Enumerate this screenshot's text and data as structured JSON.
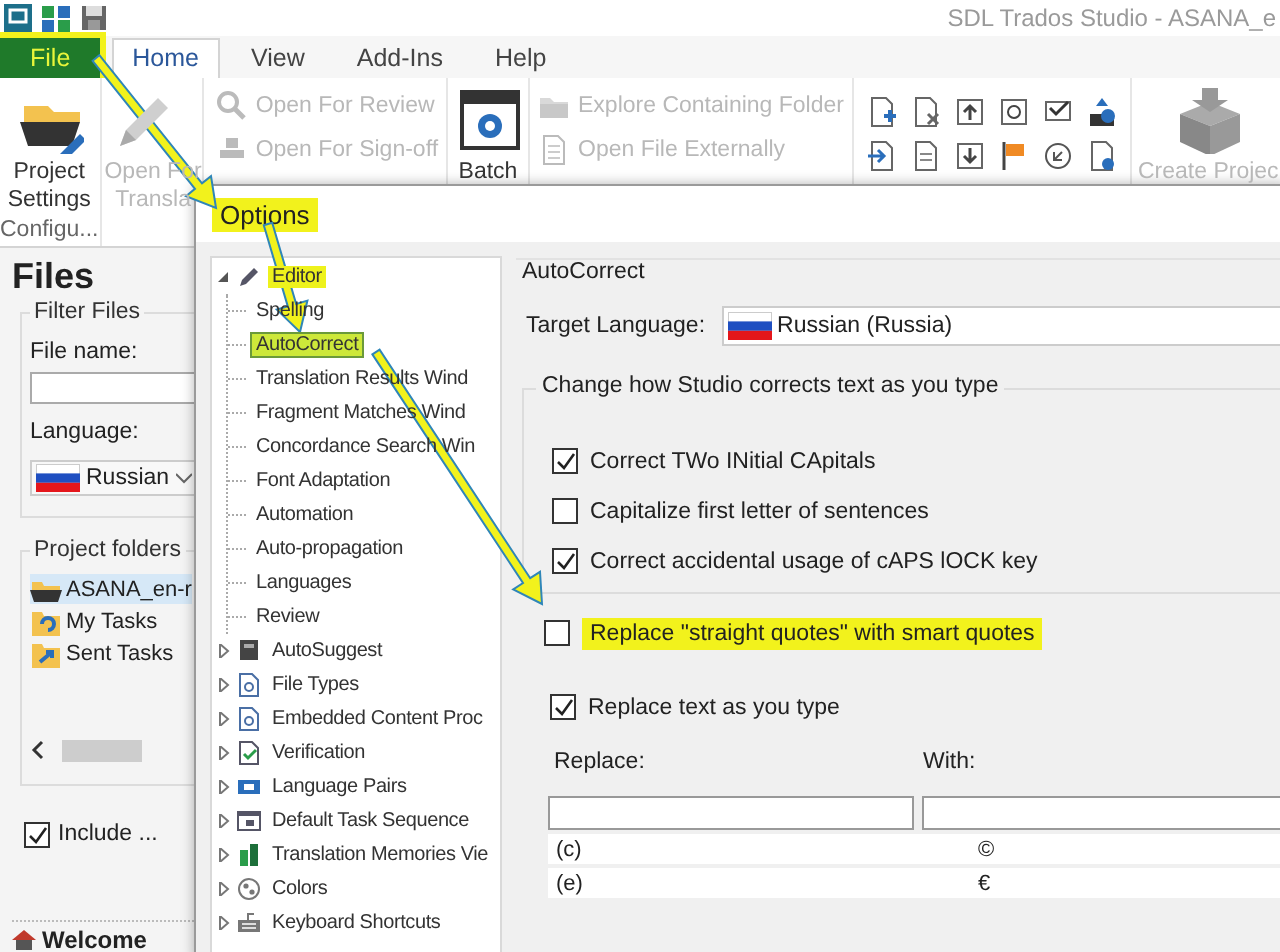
{
  "app": {
    "title": "SDL Trados Studio - ASANA_e"
  },
  "ribbon_tabs": [
    {
      "label": "File",
      "kind": "file",
      "selected": false,
      "highlighted": true
    },
    {
      "label": "Home",
      "kind": "tab",
      "selected": true,
      "highlighted": false
    },
    {
      "label": "View",
      "kind": "tab",
      "selected": false,
      "highlighted": false
    },
    {
      "label": "Add-Ins",
      "kind": "tab",
      "selected": false,
      "highlighted": false
    },
    {
      "label": "Help",
      "kind": "tab",
      "selected": false,
      "highlighted": false
    }
  ],
  "ribbon": [
    {
      "kind": "large",
      "lines": [
        "Project",
        "Settings"
      ],
      "caption": "Configu...",
      "disabled": false
    },
    {
      "kind": "large",
      "lines": [
        "Open For",
        "Transla"
      ],
      "disabled": true
    },
    {
      "kind": "small",
      "items": [
        {
          "label": "Open For Review",
          "disabled": true
        },
        {
          "label": "Open For Sign-off",
          "disabled": true
        }
      ]
    },
    {
      "kind": "large",
      "lines": [
        "Batch"
      ],
      "disabled": false
    },
    {
      "kind": "small",
      "items": [
        {
          "label": "Explore Containing Folder",
          "disabled": true
        },
        {
          "label": "Open File Externally",
          "disabled": true
        }
      ]
    },
    {
      "kind": "grid"
    },
    {
      "kind": "large",
      "lines": [
        "Create Projec"
      ],
      "disabled": true
    }
  ],
  "files_panel": {
    "heading": "Files",
    "filter_title": "Filter Files",
    "file_name_label": "File name:",
    "language_label": "Language:",
    "language": "Russian",
    "folders_title": "Project folders",
    "folders": [
      {
        "label": "ASANA_en-r",
        "selected": true
      },
      {
        "label": "My Tasks",
        "selected": false
      },
      {
        "label": "Sent Tasks",
        "selected": false
      }
    ],
    "include": {
      "label": "Include ...",
      "checked": true
    },
    "welcome": "Welcome"
  },
  "dialog": {
    "title": "Options",
    "title_highlighted": true,
    "tree": [
      {
        "label": "Editor",
        "expanded": true,
        "selected": false,
        "highlighted": true,
        "children": [
          {
            "label": "Spelling",
            "selected": false,
            "highlighted": false
          },
          {
            "label": "AutoCorrect",
            "selected": true,
            "highlighted": true
          },
          {
            "label": "Translation Results Wind",
            "selected": false,
            "highlighted": false
          },
          {
            "label": "Fragment Matches Wind",
            "selected": false,
            "highlighted": false
          },
          {
            "label": "Concordance Search Win",
            "selected": false,
            "highlighted": false
          },
          {
            "label": "Font Adaptation",
            "selected": false,
            "highlighted": false
          },
          {
            "label": "Automation",
            "selected": false,
            "highlighted": false
          },
          {
            "label": "Auto-propagation",
            "selected": false,
            "highlighted": false
          },
          {
            "label": "Languages",
            "selected": false,
            "highlighted": false
          },
          {
            "label": "Review",
            "selected": false,
            "highlighted": false
          }
        ]
      },
      {
        "label": "AutoSuggest",
        "expanded": false,
        "selected": false,
        "highlighted": false
      },
      {
        "label": "File Types",
        "expanded": false,
        "selected": false,
        "highlighted": false
      },
      {
        "label": "Embedded Content Proc",
        "expanded": false,
        "selected": false,
        "highlighted": false
      },
      {
        "label": "Verification",
        "expanded": false,
        "selected": false,
        "highlighted": false
      },
      {
        "label": "Language Pairs",
        "expanded": false,
        "selected": false,
        "highlighted": false
      },
      {
        "label": "Default Task Sequence",
        "expanded": false,
        "selected": false,
        "highlighted": false
      },
      {
        "label": "Translation Memories Vie",
        "expanded": false,
        "selected": false,
        "highlighted": false
      },
      {
        "label": "Colors",
        "expanded": false,
        "selected": false,
        "highlighted": false
      },
      {
        "label": "Keyboard Shortcuts",
        "expanded": false,
        "selected": false,
        "highlighted": false
      }
    ],
    "page": {
      "title": "AutoCorrect",
      "target_language_label": "Target Language:",
      "target_language": "Russian (Russia)",
      "group_title": "Change how Studio corrects text as you type",
      "options": [
        {
          "label": "Correct TWo INitial CApitals",
          "checked": true,
          "highlighted": false
        },
        {
          "label": "Capitalize first letter of sentences",
          "checked": false,
          "highlighted": false
        },
        {
          "label": "Correct accidental usage of cAPS lOCK key",
          "checked": true,
          "highlighted": false
        }
      ],
      "quotes_option": {
        "label": "Replace \"straight quotes\" with smart quotes",
        "checked": false,
        "highlighted": true
      },
      "replace_option": {
        "label": "Replace text as you type",
        "checked": true,
        "highlighted": false
      },
      "columns": [
        "Replace:",
        "With:"
      ],
      "rows": [
        [
          "(c)",
          "©"
        ],
        [
          "(e)",
          "€"
        ]
      ]
    }
  }
}
